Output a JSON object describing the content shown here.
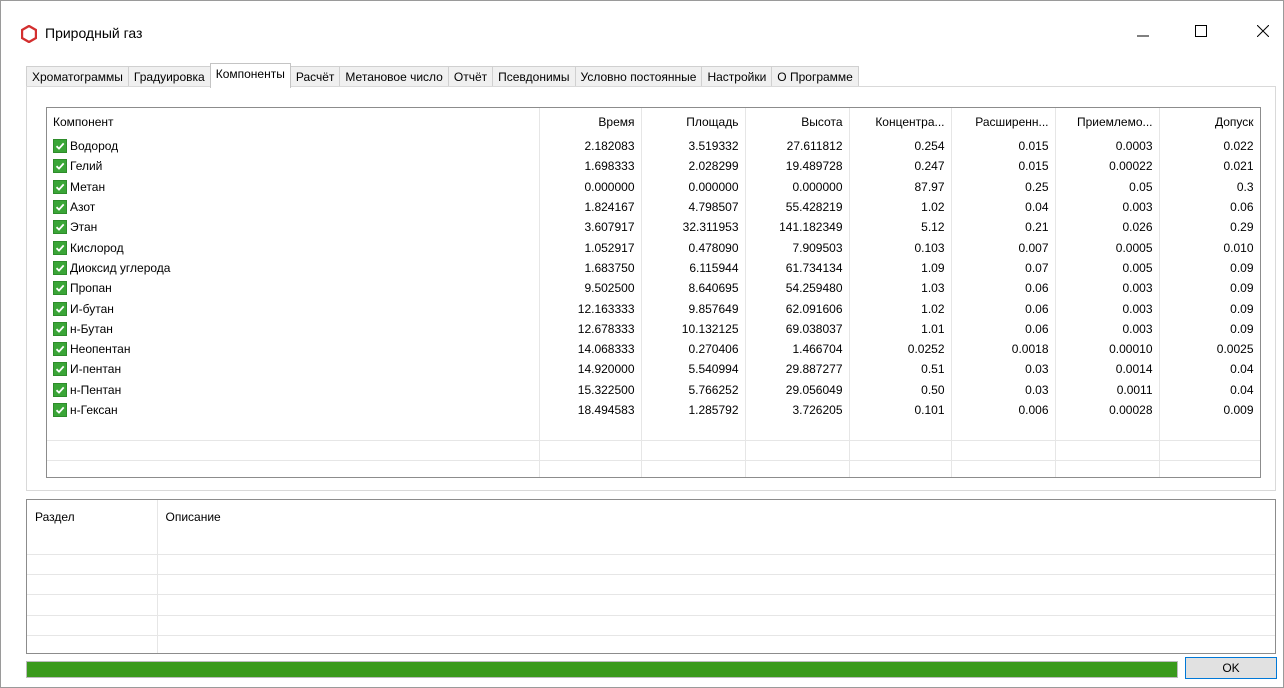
{
  "window": {
    "title": "Природный газ"
  },
  "colors": {
    "check": "#3aa537",
    "progress": "#3a9a1c",
    "ok_border": "#0078d7",
    "app_icon": "#d32f2f"
  },
  "tabs": [
    {
      "label": "Хроматограммы"
    },
    {
      "label": "Градуировка"
    },
    {
      "label": "Компоненты"
    },
    {
      "label": "Расчёт"
    },
    {
      "label": "Метановое число"
    },
    {
      "label": "Отчёт"
    },
    {
      "label": "Псевдонимы"
    },
    {
      "label": "Условно постоянные"
    },
    {
      "label": "Настройки"
    },
    {
      "label": "О Программе"
    }
  ],
  "active_tab": "Компоненты",
  "components_table": {
    "columns": [
      "Компонент",
      "Время",
      "Площадь",
      "Высота",
      "Концентра...",
      "Расширенн...",
      "Приемлемо...",
      "Допуск"
    ],
    "rows": [
      {
        "checked": true,
        "name": "Водород",
        "time": "2.182083",
        "area": "3.519332",
        "height": "27.611812",
        "conc": "0.254",
        "ext": "0.015",
        "acc": "0.0003",
        "tol": "0.022"
      },
      {
        "checked": true,
        "name": "Гелий",
        "time": "1.698333",
        "area": "2.028299",
        "height": "19.489728",
        "conc": "0.247",
        "ext": "0.015",
        "acc": "0.00022",
        "tol": "0.021"
      },
      {
        "checked": true,
        "name": "Метан",
        "time": "0.000000",
        "area": "0.000000",
        "height": "0.000000",
        "conc": "87.97",
        "ext": "0.25",
        "acc": "0.05",
        "tol": "0.3"
      },
      {
        "checked": true,
        "name": "Азот",
        "time": "1.824167",
        "area": "4.798507",
        "height": "55.428219",
        "conc": "1.02",
        "ext": "0.04",
        "acc": "0.003",
        "tol": "0.06"
      },
      {
        "checked": true,
        "name": "Этан",
        "time": "3.607917",
        "area": "32.311953",
        "height": "141.182349",
        "conc": "5.12",
        "ext": "0.21",
        "acc": "0.026",
        "tol": "0.29"
      },
      {
        "checked": true,
        "name": "Кислород",
        "time": "1.052917",
        "area": "0.478090",
        "height": "7.909503",
        "conc": "0.103",
        "ext": "0.007",
        "acc": "0.0005",
        "tol": "0.010"
      },
      {
        "checked": true,
        "name": "Диоксид углерода",
        "time": "1.683750",
        "area": "6.115944",
        "height": "61.734134",
        "conc": "1.09",
        "ext": "0.07",
        "acc": "0.005",
        "tol": "0.09"
      },
      {
        "checked": true,
        "name": "Пропан",
        "time": "9.502500",
        "area": "8.640695",
        "height": "54.259480",
        "conc": "1.03",
        "ext": "0.06",
        "acc": "0.003",
        "tol": "0.09"
      },
      {
        "checked": true,
        "name": "И-бутан",
        "time": "12.163333",
        "area": "9.857649",
        "height": "62.091606",
        "conc": "1.02",
        "ext": "0.06",
        "acc": "0.003",
        "tol": "0.09"
      },
      {
        "checked": true,
        "name": "н-Бутан",
        "time": "12.678333",
        "area": "10.132125",
        "height": "69.038037",
        "conc": "1.01",
        "ext": "0.06",
        "acc": "0.003",
        "tol": "0.09"
      },
      {
        "checked": true,
        "name": "Неопентан",
        "time": "14.068333",
        "area": "0.270406",
        "height": "1.466704",
        "conc": "0.0252",
        "ext": "0.0018",
        "acc": "0.00010",
        "tol": "0.0025"
      },
      {
        "checked": true,
        "name": "И-пентан",
        "time": "14.920000",
        "area": "5.540994",
        "height": "29.887277",
        "conc": "0.51",
        "ext": "0.03",
        "acc": "0.0014",
        "tol": "0.04"
      },
      {
        "checked": true,
        "name": "н-Пентан",
        "time": "15.322500",
        "area": "5.766252",
        "height": "29.056049",
        "conc": "0.50",
        "ext": "0.03",
        "acc": "0.0011",
        "tol": "0.04"
      },
      {
        "checked": true,
        "name": "н-Гексан",
        "time": "18.494583",
        "area": "1.285792",
        "height": "3.726205",
        "conc": "0.101",
        "ext": "0.006",
        "acc": "0.00028",
        "tol": "0.009"
      }
    ]
  },
  "description_table": {
    "columns": [
      "Раздел",
      "Описание"
    ]
  },
  "progress": {
    "percent": 100
  },
  "ok_label": "OK"
}
